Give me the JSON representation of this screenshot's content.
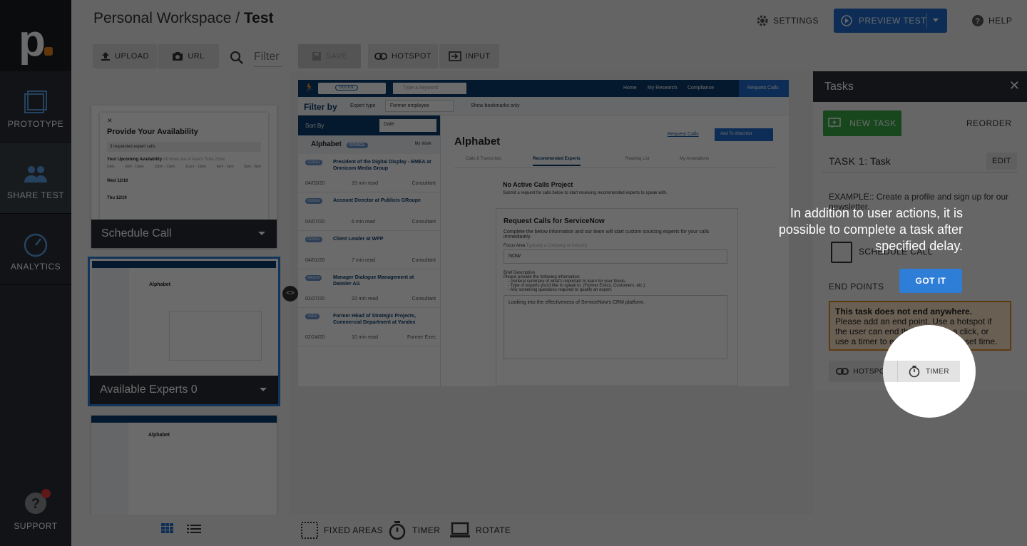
{
  "sidebar": {
    "logo_letter": "p",
    "items": [
      {
        "label": "PROTOTYPE",
        "icon": "square-outline-icon"
      },
      {
        "label": "SHARE TEST",
        "icon": "users-icon"
      },
      {
        "label": "ANALYTICS",
        "icon": "gauge-icon"
      }
    ],
    "support_label": "SUPPORT"
  },
  "header": {
    "workspace": "Personal Workspace",
    "separator": "/",
    "project": "Test",
    "settings_label": "SETTINGS",
    "preview_label": "PREVIEW TEST",
    "help_label": "HELP"
  },
  "toolbar": {
    "upload_label": "UPLOAD",
    "url_label": "URL",
    "filter_placeholder": "Filter",
    "save_label": "SAVE",
    "hotspot_label": "HOTSPOT",
    "input_label": "INPUT"
  },
  "screens": [
    {
      "name": "Schedule Call",
      "selected": false
    },
    {
      "name": "Available Experts 0",
      "selected": true
    },
    {
      "name": "",
      "selected": false
    }
  ],
  "thumb_schedule": {
    "title": "Provide Your Availability",
    "requested": "3 requested expert calls",
    "upcoming": "Your Upcoming Availability",
    "tz": "All times are in Asia's Time Zone",
    "cols": [
      "Date",
      "9am - 10pm",
      "10pm - 11pm",
      "11am - 12pm",
      "4pm - 5pm",
      "6pm - 6pm"
    ],
    "rows": [
      "Wed 12/18",
      "Thu 12/19"
    ]
  },
  "preview_screen": {
    "nav": {
      "search_chip": "GOOGL",
      "search_placeholder": "Type a keyword",
      "links": [
        "Home",
        "My Research",
        "Compliance"
      ],
      "cta": "Request Calls"
    },
    "filter_by": "Filter by",
    "expert_type": "Expert type",
    "expert_value": "Former employee",
    "show_bookmarks": "Show bookmarks only",
    "sort_by": "Sort By",
    "sort_value": "Date",
    "company": "Alphabet",
    "company_tag": "GOOGL",
    "my_work": "My Work",
    "items": [
      {
        "tag": "GOOGL",
        "title": "President of the Digital Display - EMEA at Omnicom Media Group",
        "date": "04/03/20",
        "read": "15 min read",
        "type": "Consultant"
      },
      {
        "tag": "GOOGL",
        "title": "Account Director at Publicis GRoupe",
        "date": "04/07/20",
        "read": "6 min read",
        "type": "Consultant"
      },
      {
        "tag": "GOOGL",
        "title": "Client Leader at WPP",
        "date": "04/01/20",
        "read": "7 min read",
        "type": "Consultant"
      },
      {
        "tag": "NASDA",
        "title": "Manager Dialogue Management at Daimler AG",
        "date": "02/27/20",
        "read": "22 min read",
        "type": "Consultant"
      },
      {
        "tag": "YNDX",
        "title": "Former HEad of Strategic Projects, Commercial Department at Yandex",
        "date": "02/24/20",
        "read": "10 min read",
        "type": "Former Exec"
      }
    ],
    "main_title": "Alphabet",
    "request_link": "Request Calls",
    "watchlist": "Add To Watchlist",
    "tabs": [
      "Calls & Transcripts",
      "Recommended Experts",
      "Reading List",
      "My Annotations"
    ],
    "no_active": "No Active Calls Project",
    "no_active_sub": "Submit a request for calls below to start receiving recommended experts to speak with.",
    "request_title": "Request Calls for ServiceNow",
    "request_sub": "Complete the below information and our team will start custom sourcing experts for your calls immediately.",
    "focus_label": "Focus Area",
    "focus_hint": "Typically a Company or Industry",
    "focus_value": "NOW",
    "brief_label": "Brief Description",
    "brief_intro": "Please provide the following information:",
    "brief_points": [
      "General summary of what's important to learn for your thesis.",
      "Type of experts you'd like to speak to. (Former Execs, Customers, etc.)",
      "Any screening questions required to qualify an expert."
    ],
    "brief_value": "Looking into the effectiveness of ServiceNow's CRM platform."
  },
  "tasks": {
    "title": "Tasks",
    "new_task": "NEW TASK",
    "reorder": "REORDER",
    "task_label": "TASK 1:",
    "task_name": "Task",
    "edit": "EDIT",
    "example": "EXAMPLE:: Create a profile and sign up for our newsletter.",
    "start_screen": "SCHEDULE CALL",
    "end_points": "END POINTS",
    "warning_title": "This task does not end anywhere.",
    "warning_body": "Please add an end point. Use a hotspot if the user can end this task with a click, or use a timer to end the task after a set time.",
    "hotspot": "HOTSPOT",
    "timer": "TIMER"
  },
  "bottom": {
    "fixed_areas": "FIXED AREAS",
    "timer": "TIMER",
    "rotate": "ROTATE"
  },
  "tutorial": {
    "message": "In addition to user actions, it is possible to complete a task after specified delay.",
    "button": "GOT IT"
  },
  "colors": {
    "accent": "#1f6dcc",
    "green": "#3aa845",
    "warning_bg": "#f9e2c6",
    "warning_border": "#e08a2e",
    "logo_dot": "#e8801a"
  }
}
